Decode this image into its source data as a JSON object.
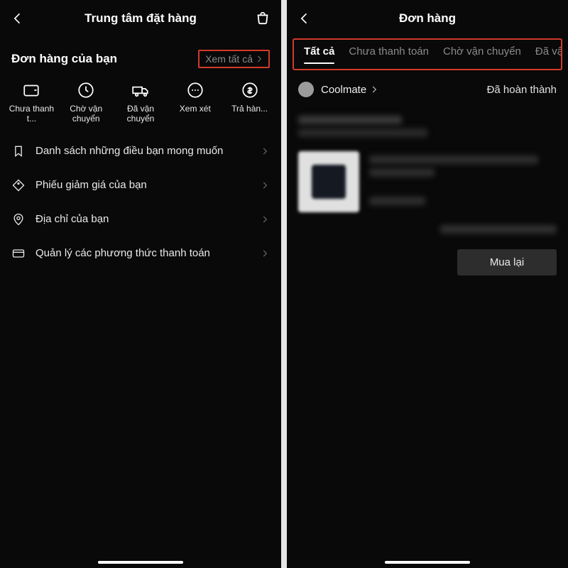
{
  "left": {
    "header": {
      "title": "Trung tâm đặt hàng"
    },
    "section": {
      "title": "Đơn hàng của bạn",
      "see_all": "Xem tất cả"
    },
    "statuses": [
      {
        "label": "Chưa thanh t..."
      },
      {
        "label": "Chờ vận chuyển"
      },
      {
        "label": "Đã vận chuyển"
      },
      {
        "label": "Xem xét"
      },
      {
        "label": "Trả hàn..."
      }
    ],
    "menu": [
      {
        "label": "Danh sách những điều bạn mong muốn"
      },
      {
        "label": "Phiếu giảm giá của bạn"
      },
      {
        "label": "Địa chỉ của bạn"
      },
      {
        "label": "Quản lý các phương thức thanh toán"
      }
    ]
  },
  "right": {
    "header": {
      "title": "Đơn hàng"
    },
    "tabs": [
      {
        "label": "Tất cả",
        "active": true
      },
      {
        "label": "Chưa thanh toán",
        "active": false
      },
      {
        "label": "Chờ vận chuyển",
        "active": false
      },
      {
        "label": "Đã vậ",
        "active": false
      }
    ],
    "shop": {
      "name": "Coolmate",
      "status": "Đã hoàn thành"
    },
    "buy_again": "Mua lại"
  }
}
